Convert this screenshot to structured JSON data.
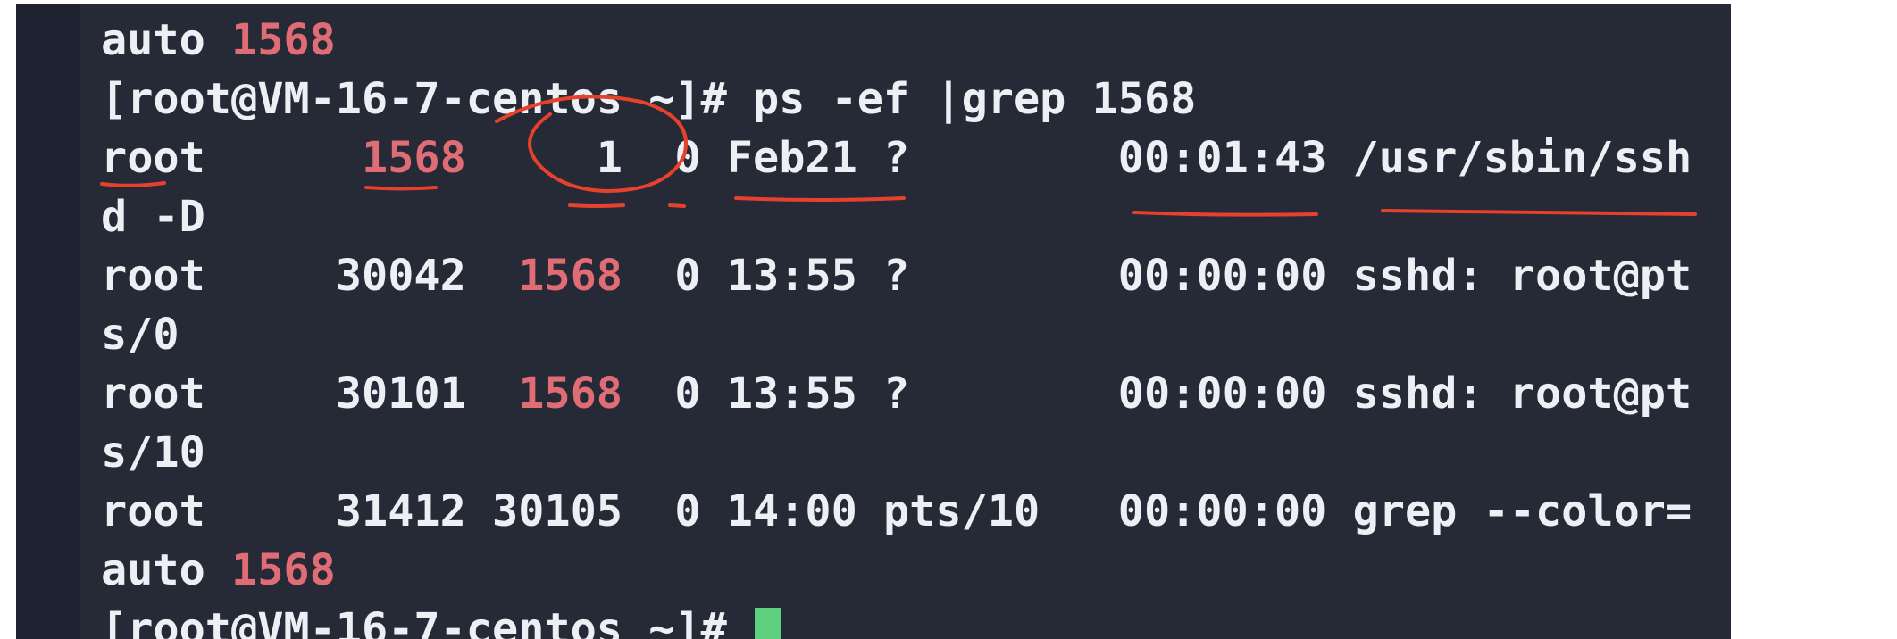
{
  "terminal": {
    "lines": [
      {
        "pre": "",
        "hl": "",
        "post": "auto ",
        "hl2": "1568"
      },
      {
        "pre": "[root@VM-16-7-centos ~]# ps -ef |grep 1568"
      },
      {
        "pre": "root      ",
        "hl": "1568",
        "post": "     1  0 Feb21 ?        00:01:43 /usr/sbin/ssh"
      },
      {
        "pre": "d -D"
      },
      {
        "pre": "root     30042  ",
        "hl": "1568",
        "post": "  0 13:55 ?        00:00:00 sshd: root@pt"
      },
      {
        "pre": "s/0"
      },
      {
        "pre": "root     30101  ",
        "hl": "1568",
        "post": "  0 13:55 ?        00:00:00 sshd: root@pt"
      },
      {
        "pre": "s/10"
      },
      {
        "pre": "root     31412 30105  0 14:00 pts/10   00:00:00 grep --color="
      },
      {
        "pre": "auto ",
        "hl": "1568"
      },
      {
        "pre": "[root@VM-16-7-centos ~]# "
      }
    ]
  },
  "colors": {
    "background": "#262a36",
    "gutter": "#1f2230",
    "text": "#eceff4",
    "match_highlight": "#e06c75",
    "cursor": "#5fcf80",
    "annotation_ink": "#e5412d"
  },
  "icons": {
    "cursor": "block-cursor-icon"
  }
}
